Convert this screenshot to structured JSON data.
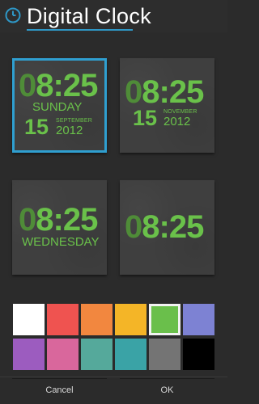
{
  "app": {
    "title": "Digital Clock",
    "icon": "clock-icon",
    "accent": "#2e97c6"
  },
  "tiles": [
    {
      "time_zero": "0",
      "time_rest": "8:25",
      "day": "SUNDAY",
      "daynum": "15",
      "month": "SEPTEMBER",
      "year": "2012"
    },
    {
      "time_zero": "0",
      "time_rest": "8:25",
      "daynum": "15",
      "month": "NOVEMBER",
      "year": "2012"
    },
    {
      "time_zero": "0",
      "time_rest": "8:25",
      "day": "WEDNESDAY"
    },
    {
      "time_zero": "0",
      "time_rest": "8:25"
    }
  ],
  "colors": [
    "#ffffff",
    "#ef5350",
    "#f2873f",
    "#f4b527",
    "#6abf4b",
    "#7d82d3",
    "#9c5cbf",
    "#d9679c",
    "#55a99b",
    "#3aa3a6",
    "#747474",
    "#000000"
  ],
  "selected_color": "#6abf4b",
  "buttons": {
    "cancel": "Cancel",
    "ok": "OK"
  }
}
